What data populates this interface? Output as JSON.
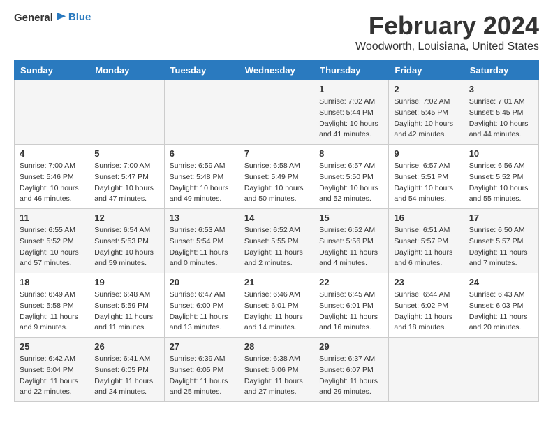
{
  "logo": {
    "text_general": "General",
    "text_blue": "Blue"
  },
  "title": "February 2024",
  "subtitle": "Woodworth, Louisiana, United States",
  "headers": [
    "Sunday",
    "Monday",
    "Tuesday",
    "Wednesday",
    "Thursday",
    "Friday",
    "Saturday"
  ],
  "weeks": [
    [
      {
        "day": "",
        "info": ""
      },
      {
        "day": "",
        "info": ""
      },
      {
        "day": "",
        "info": ""
      },
      {
        "day": "",
        "info": ""
      },
      {
        "day": "1",
        "info": "Sunrise: 7:02 AM\nSunset: 5:44 PM\nDaylight: 10 hours\nand 41 minutes."
      },
      {
        "day": "2",
        "info": "Sunrise: 7:02 AM\nSunset: 5:45 PM\nDaylight: 10 hours\nand 42 minutes."
      },
      {
        "day": "3",
        "info": "Sunrise: 7:01 AM\nSunset: 5:45 PM\nDaylight: 10 hours\nand 44 minutes."
      }
    ],
    [
      {
        "day": "4",
        "info": "Sunrise: 7:00 AM\nSunset: 5:46 PM\nDaylight: 10 hours\nand 46 minutes."
      },
      {
        "day": "5",
        "info": "Sunrise: 7:00 AM\nSunset: 5:47 PM\nDaylight: 10 hours\nand 47 minutes."
      },
      {
        "day": "6",
        "info": "Sunrise: 6:59 AM\nSunset: 5:48 PM\nDaylight: 10 hours\nand 49 minutes."
      },
      {
        "day": "7",
        "info": "Sunrise: 6:58 AM\nSunset: 5:49 PM\nDaylight: 10 hours\nand 50 minutes."
      },
      {
        "day": "8",
        "info": "Sunrise: 6:57 AM\nSunset: 5:50 PM\nDaylight: 10 hours\nand 52 minutes."
      },
      {
        "day": "9",
        "info": "Sunrise: 6:57 AM\nSunset: 5:51 PM\nDaylight: 10 hours\nand 54 minutes."
      },
      {
        "day": "10",
        "info": "Sunrise: 6:56 AM\nSunset: 5:52 PM\nDaylight: 10 hours\nand 55 minutes."
      }
    ],
    [
      {
        "day": "11",
        "info": "Sunrise: 6:55 AM\nSunset: 5:52 PM\nDaylight: 10 hours\nand 57 minutes."
      },
      {
        "day": "12",
        "info": "Sunrise: 6:54 AM\nSunset: 5:53 PM\nDaylight: 10 hours\nand 59 minutes."
      },
      {
        "day": "13",
        "info": "Sunrise: 6:53 AM\nSunset: 5:54 PM\nDaylight: 11 hours\nand 0 minutes."
      },
      {
        "day": "14",
        "info": "Sunrise: 6:52 AM\nSunset: 5:55 PM\nDaylight: 11 hours\nand 2 minutes."
      },
      {
        "day": "15",
        "info": "Sunrise: 6:52 AM\nSunset: 5:56 PM\nDaylight: 11 hours\nand 4 minutes."
      },
      {
        "day": "16",
        "info": "Sunrise: 6:51 AM\nSunset: 5:57 PM\nDaylight: 11 hours\nand 6 minutes."
      },
      {
        "day": "17",
        "info": "Sunrise: 6:50 AM\nSunset: 5:57 PM\nDaylight: 11 hours\nand 7 minutes."
      }
    ],
    [
      {
        "day": "18",
        "info": "Sunrise: 6:49 AM\nSunset: 5:58 PM\nDaylight: 11 hours\nand 9 minutes."
      },
      {
        "day": "19",
        "info": "Sunrise: 6:48 AM\nSunset: 5:59 PM\nDaylight: 11 hours\nand 11 minutes."
      },
      {
        "day": "20",
        "info": "Sunrise: 6:47 AM\nSunset: 6:00 PM\nDaylight: 11 hours\nand 13 minutes."
      },
      {
        "day": "21",
        "info": "Sunrise: 6:46 AM\nSunset: 6:01 PM\nDaylight: 11 hours\nand 14 minutes."
      },
      {
        "day": "22",
        "info": "Sunrise: 6:45 AM\nSunset: 6:01 PM\nDaylight: 11 hours\nand 16 minutes."
      },
      {
        "day": "23",
        "info": "Sunrise: 6:44 AM\nSunset: 6:02 PM\nDaylight: 11 hours\nand 18 minutes."
      },
      {
        "day": "24",
        "info": "Sunrise: 6:43 AM\nSunset: 6:03 PM\nDaylight: 11 hours\nand 20 minutes."
      }
    ],
    [
      {
        "day": "25",
        "info": "Sunrise: 6:42 AM\nSunset: 6:04 PM\nDaylight: 11 hours\nand 22 minutes."
      },
      {
        "day": "26",
        "info": "Sunrise: 6:41 AM\nSunset: 6:05 PM\nDaylight: 11 hours\nand 24 minutes."
      },
      {
        "day": "27",
        "info": "Sunrise: 6:39 AM\nSunset: 6:05 PM\nDaylight: 11 hours\nand 25 minutes."
      },
      {
        "day": "28",
        "info": "Sunrise: 6:38 AM\nSunset: 6:06 PM\nDaylight: 11 hours\nand 27 minutes."
      },
      {
        "day": "29",
        "info": "Sunrise: 6:37 AM\nSunset: 6:07 PM\nDaylight: 11 hours\nand 29 minutes."
      },
      {
        "day": "",
        "info": ""
      },
      {
        "day": "",
        "info": ""
      }
    ]
  ]
}
